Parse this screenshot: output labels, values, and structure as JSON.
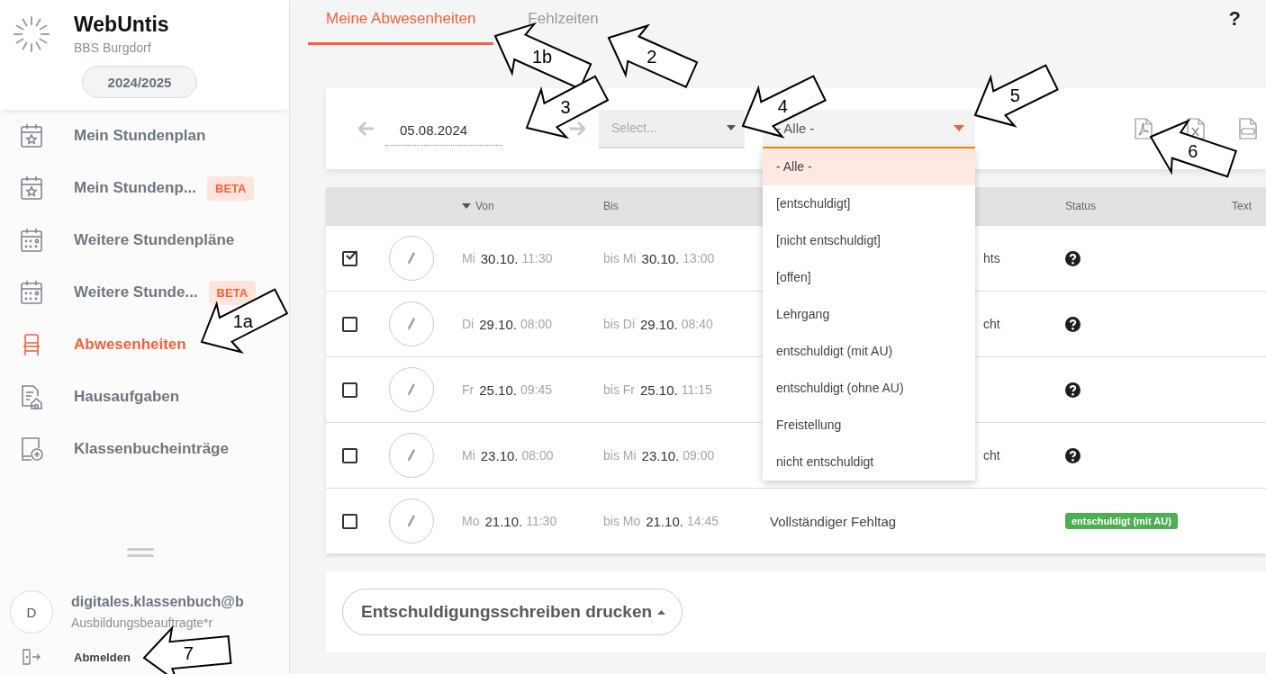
{
  "sidebar": {
    "app_name": "WebUntis",
    "school": "BBS Burgdorf",
    "school_year": "2024/2025",
    "items": [
      {
        "label": "Mein Stundenplan",
        "kind": "calendar-star",
        "selected": false
      },
      {
        "label": "Mein Stundenp...",
        "kind": "calendar-star",
        "selected": false,
        "badge": "BETA"
      },
      {
        "label": "Weitere Stundenpläne",
        "kind": "calendar-grid",
        "selected": false
      },
      {
        "label": "Weitere Stunde...",
        "kind": "calendar-grid",
        "selected": false,
        "badge": "BETA"
      },
      {
        "label": "Abwesenheiten",
        "kind": "chair",
        "selected": true
      },
      {
        "label": "Hausaufgaben",
        "kind": "homework",
        "selected": false
      },
      {
        "label": "Klassenbucheinträge",
        "kind": "book-plus",
        "selected": false
      }
    ],
    "user": {
      "initial": "D",
      "name": "digitales.klassenbuch@b",
      "role": "Ausbildungsbeauftragte*r"
    },
    "logout": "Abmelden"
  },
  "tabs": [
    {
      "label": "Meine Abwesenheiten",
      "selected": true
    },
    {
      "label": "Fehlzeiten",
      "selected": false
    }
  ],
  "help": "?",
  "filters": {
    "date": "05.08.2024",
    "select": {
      "placeholder": "Select..."
    },
    "status_select": {
      "value": "- Alle -",
      "focused": true,
      "expanded": true,
      "options": [
        {
          "label": "- Alle -",
          "selected": true
        },
        {
          "label": "[entschuldigt]",
          "selected": false
        },
        {
          "label": "[nicht entschuldigt]",
          "selected": false
        },
        {
          "label": "[offen]",
          "selected": false
        },
        {
          "label": "Lehrgang",
          "selected": false
        },
        {
          "label": "entschuldigt (mit AU)",
          "selected": false
        },
        {
          "label": "entschuldigt (ohne AU)",
          "selected": false
        },
        {
          "label": "Freistellung",
          "selected": false
        },
        {
          "label": "nicht entschuldigt",
          "selected": false
        }
      ]
    }
  },
  "table": {
    "headers": {
      "from": "Von",
      "to": "Bis",
      "status": "Status",
      "text": "Text"
    },
    "rows": [
      {
        "checked": true,
        "from_day": "Mi",
        "from_date": "30.10.",
        "from_time": "11:30",
        "to_day": "bis Mi",
        "to_date": "30.10.",
        "to_time": "13:00",
        "reason_tail": "hts",
        "status": {
          "kind": "unknown"
        }
      },
      {
        "checked": false,
        "from_day": "Di",
        "from_date": "29.10.",
        "from_time": "08:00",
        "to_day": "bis Di",
        "to_date": "29.10.",
        "to_time": "08:40",
        "reason_tail": "cht",
        "status": {
          "kind": "unknown"
        }
      },
      {
        "checked": false,
        "from_day": "Fr",
        "from_date": "25.10.",
        "from_time": "09:45",
        "to_day": "bis Fr",
        "to_date": "25.10.",
        "to_time": "11:15",
        "status": {
          "kind": "unknown"
        }
      },
      {
        "checked": false,
        "from_day": "Mi",
        "from_date": "23.10.",
        "from_time": "08:00",
        "to_day": "bis Mi",
        "to_date": "23.10.",
        "to_time": "09:00",
        "reason_tail": "cht",
        "status": {
          "kind": "unknown"
        }
      },
      {
        "checked": false,
        "from_day": "Mo",
        "from_date": "21.10.",
        "from_time": "11:30",
        "to_day": "bis Mo",
        "to_date": "21.10.",
        "to_time": "14:45",
        "reason": "Vollständiger Fehltag",
        "status": {
          "kind": "badge",
          "label": "entschuldigt (mit AU)"
        }
      }
    ]
  },
  "print_button": "Entschuldigungsschreiben drucken",
  "callouts": [
    {
      "label": "1b"
    },
    {
      "label": "2"
    },
    {
      "label": "3"
    },
    {
      "label": "4"
    },
    {
      "label": "5"
    },
    {
      "label": "6"
    },
    {
      "label": "1a"
    },
    {
      "label": "7"
    }
  ]
}
